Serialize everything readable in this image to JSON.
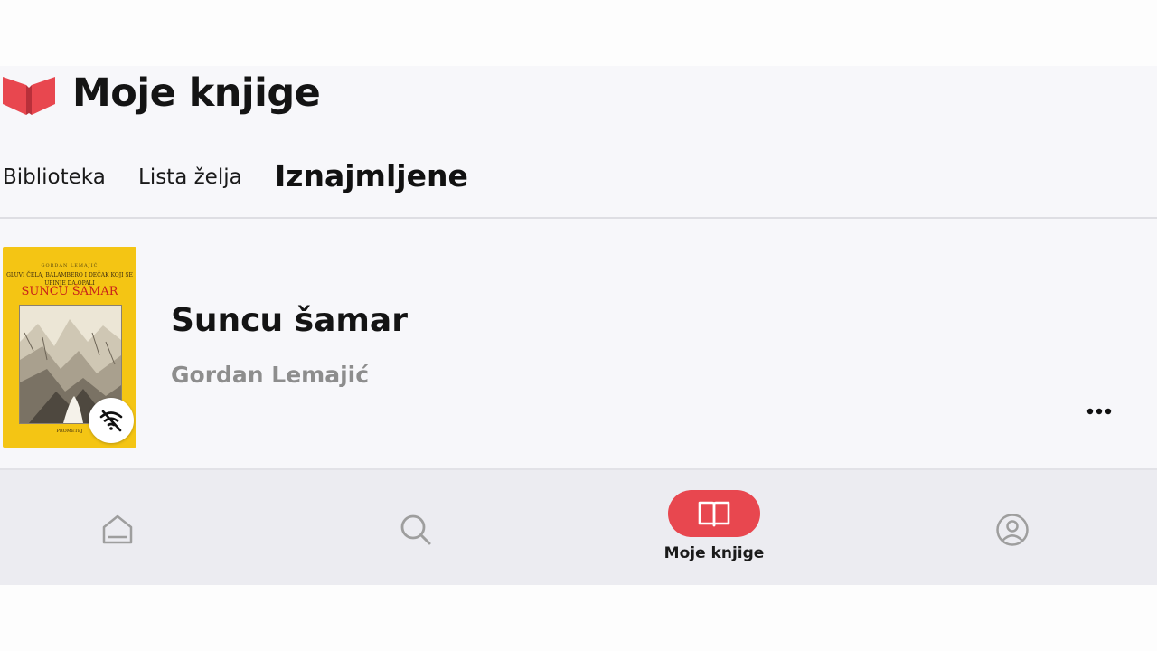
{
  "header": {
    "title": "Moje knjige",
    "logo_icon": "open-book-logo-icon",
    "logo_color": "#e8474f"
  },
  "tabs": [
    {
      "label": "Biblioteka",
      "active": false
    },
    {
      "label": "Lista želja",
      "active": false
    },
    {
      "label": "Iznajmljene",
      "active": true
    }
  ],
  "book": {
    "title": "Suncu šamar",
    "author": "Gordan Lemajić",
    "badge_icon": "wifi-off-icon",
    "menu_icon": "more-horizontal-icon",
    "cover": {
      "author_line": "GORDAN LEMAJIĆ",
      "subtitle": "GLUVI ČELA, BALAMBERO I DEČAK KOJI SE UPINJE DA OPALI",
      "title": "SUNCU ŠAMAR",
      "publisher": "PROMETEJ",
      "background": "#f4c514",
      "title_color": "#c8201a"
    }
  },
  "bottom_nav": [
    {
      "icon": "home-icon",
      "label": "",
      "active": false
    },
    {
      "icon": "search-icon",
      "label": "",
      "active": false
    },
    {
      "icon": "book-open-icon",
      "label": "Moje knjige",
      "active": true
    },
    {
      "icon": "user-circle-icon",
      "label": "",
      "active": false
    }
  ],
  "colors": {
    "accent": "#e8474f",
    "inactive_icon": "#9e9e9e",
    "secondary_text": "#8d8d8d"
  }
}
